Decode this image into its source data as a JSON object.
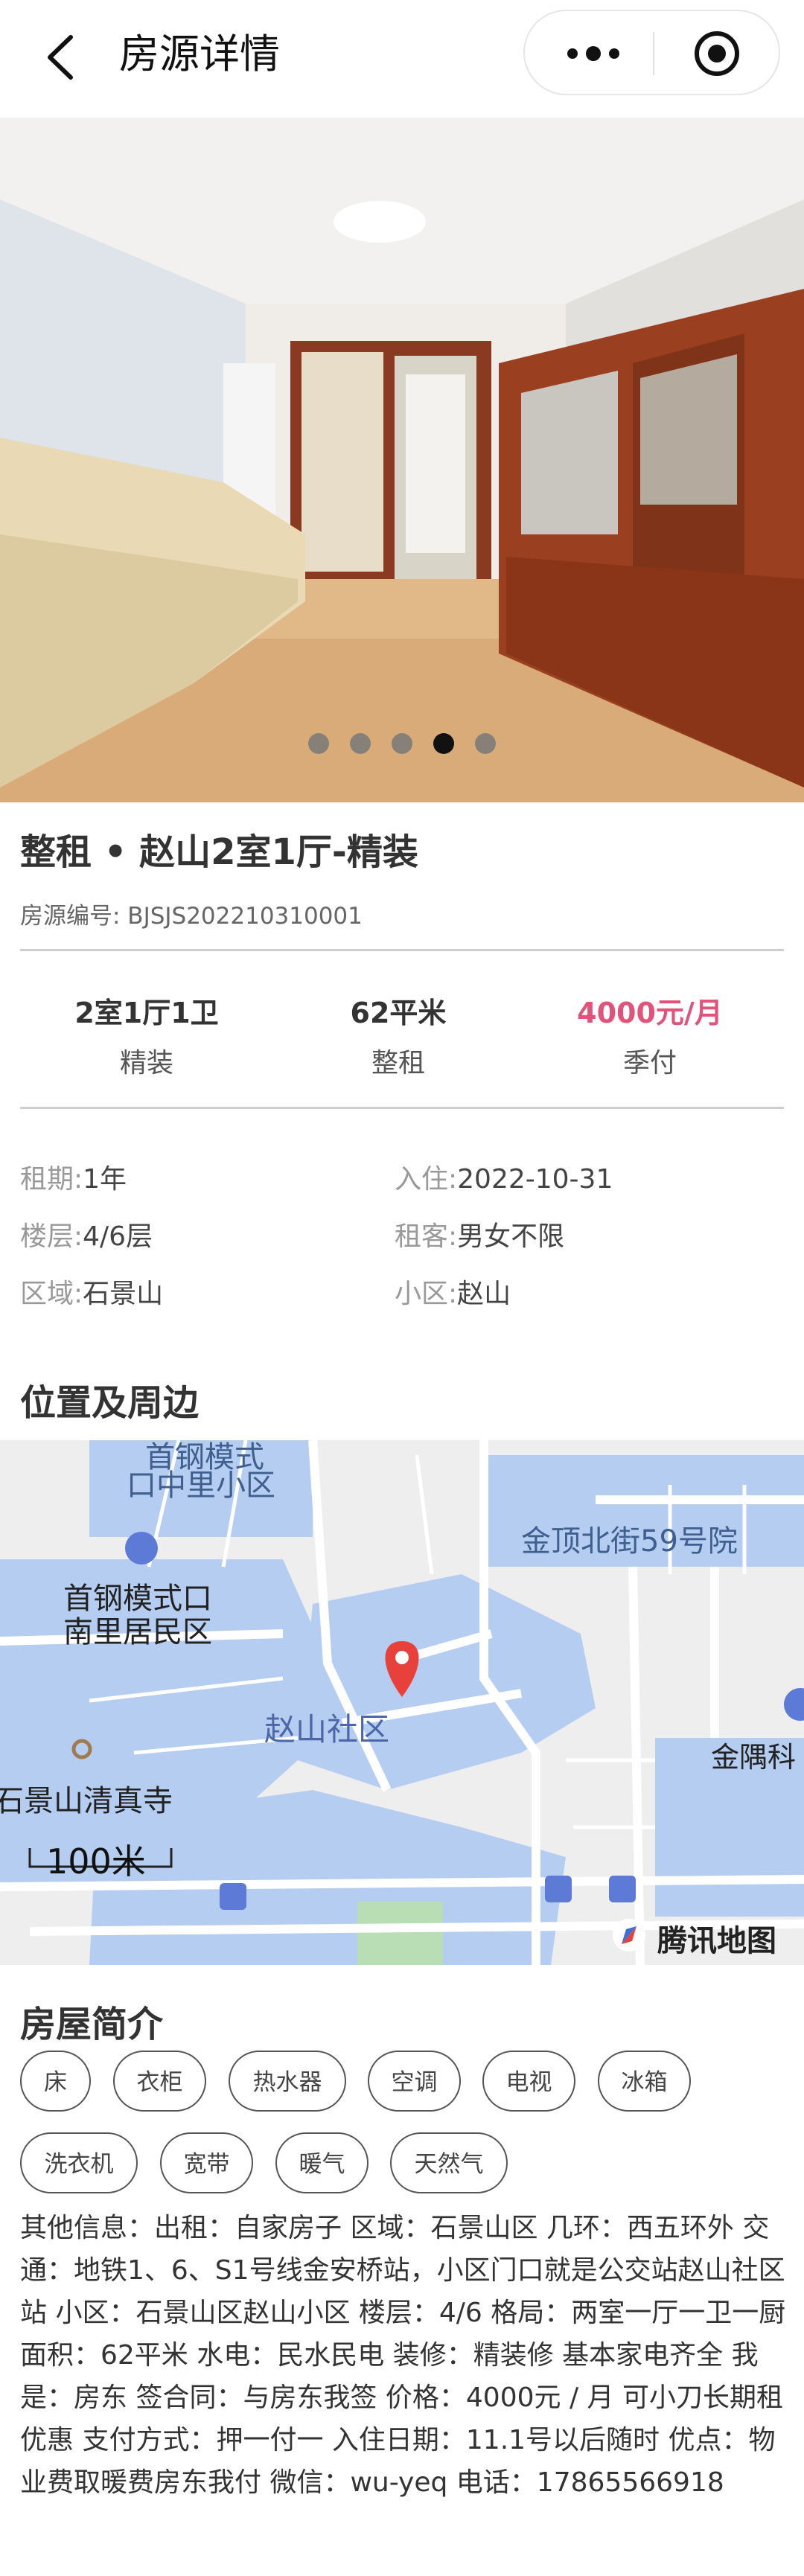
{
  "nav": {
    "title": "房源详情"
  },
  "gallery": {
    "total_images": 5,
    "active_index": 3
  },
  "listing": {
    "title": "整租 • 赵山2室1厅-精装",
    "code": "房源编号: BJSJS202210310001"
  },
  "stats": [
    {
      "value": "2室1厅1卫",
      "sub": "精装"
    },
    {
      "value": "62平米",
      "sub": "整租"
    },
    {
      "value": "4000元/月",
      "sub": "季付"
    }
  ],
  "details": {
    "lease_k": "租期:",
    "lease_v": "1年",
    "checkin_k": "入住:",
    "checkin_v": "2022-10-31",
    "floor_k": "楼层:",
    "floor_v": "4/6层",
    "tenant_k": "租客:",
    "tenant_v": "男女不限",
    "area_k": "区域:",
    "area_v": "石景山",
    "community_k": "小区:",
    "community_v": "赵山"
  },
  "location": {
    "title": "位置及周边",
    "map_labels": {
      "l1": "首钢模式",
      "l2": "口中里小区",
      "l3": "金顶北街59号院",
      "l4": "首钢模式口",
      "l5": "南里居民区",
      "l6": "赵山社区",
      "l7": "金隅科",
      "l8": "石景山清真寺",
      "scale": "100米",
      "brand": "腾讯地图"
    }
  },
  "intro": {
    "title": "房屋简介",
    "tags": [
      "床",
      "衣柜",
      "热水器",
      "空调",
      "电视",
      "冰箱",
      "洗衣机",
      "宽带",
      "暖气",
      "天然气"
    ],
    "description": "其他信息：出租：自家房子 区域：石景山区 几环：西五环外 交通：地铁1、6、S1号线金安桥站，小区门口就是公交站赵山社区站 小区：石景山区赵山小区 楼层：4/6 格局：两室一厅一卫一厨 面积：62平米 水电：民水民电 装修：精装修 基本家电齐全 我是：房东 签合同：与房东我签 价格：4000元 / 月 可小刀长期租优惠 支付方式：押一付一 入住日期：11.1号以后随时 优点：物业费取暖费房东我付 微信：wu-yeq 电话：17865566918"
  },
  "colors": {
    "price": "#e0537a",
    "map_marker": "#e8413c",
    "map_water": "#b5cdf0"
  }
}
